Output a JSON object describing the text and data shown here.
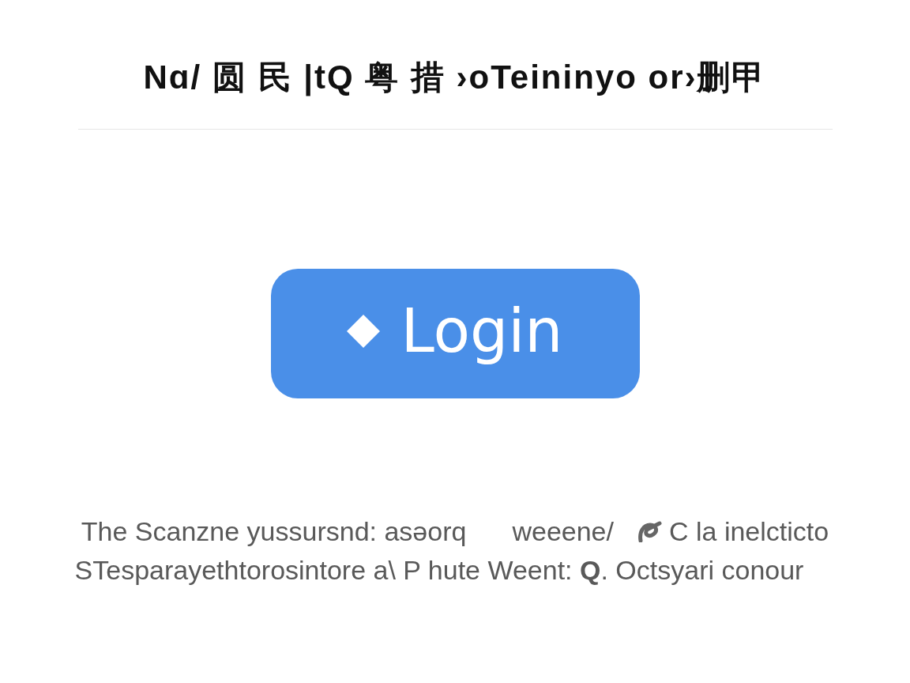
{
  "title": "Nɑ/ 圆 民 |tQ 粤 措 ›oTeininyo or›删甲",
  "login_button": {
    "label": "Login"
  },
  "footer": {
    "line_1": [
      "The Scanzne yussursnd: asəorq",
      "weeene/",
      "C la inelcticto"
    ],
    "line_2": "STesparayethtorosintore a\\ P hute Weent: **Q**. Octsyari conour"
  }
}
